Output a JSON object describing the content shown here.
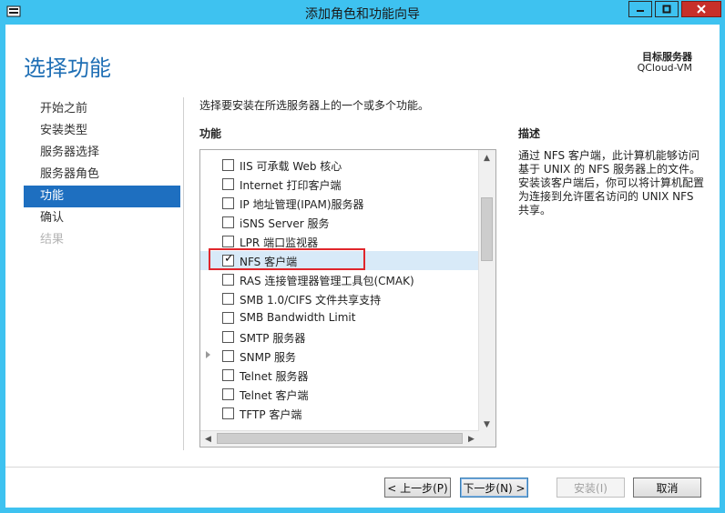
{
  "window": {
    "title": "添加角色和功能向导",
    "minimize_icon": "minimize-icon",
    "maximize_icon": "maximize-icon",
    "close_icon": "close-icon"
  },
  "header": {
    "page_title": "选择功能",
    "dest_server_label": "目标服务器",
    "dest_server_name": "QCloud-VM"
  },
  "nav": {
    "items": [
      {
        "label": "开始之前",
        "state": "normal"
      },
      {
        "label": "安装类型",
        "state": "normal"
      },
      {
        "label": "服务器选择",
        "state": "normal"
      },
      {
        "label": "服务器角色",
        "state": "normal"
      },
      {
        "label": "功能",
        "state": "active"
      },
      {
        "label": "确认",
        "state": "normal"
      },
      {
        "label": "结果",
        "state": "disabled"
      }
    ]
  },
  "main": {
    "instruction": "选择要安装在所选服务器上的一个或多个功能。",
    "features_label": "功能",
    "description_label": "描述",
    "description_text": "通过 NFS 客户端，此计算机能够访问基于 UNIX 的 NFS 服务器上的文件。安装该客户端后，你可以将计算机配置为连接到允许匿名访问的 UNIX NFS 共享。",
    "features": [
      {
        "label": "IIS 可承载 Web 核心",
        "checked": false,
        "expandable": false
      },
      {
        "label": "Internet 打印客户端",
        "checked": false,
        "expandable": false
      },
      {
        "label": "IP 地址管理(IPAM)服务器",
        "checked": false,
        "expandable": false
      },
      {
        "label": "iSNS Server 服务",
        "checked": false,
        "expandable": false
      },
      {
        "label": "LPR 端口监视器",
        "checked": false,
        "expandable": false
      },
      {
        "label": "NFS 客户端",
        "checked": true,
        "expandable": false,
        "selected": true
      },
      {
        "label": "RAS 连接管理器管理工具包(CMAK)",
        "checked": false,
        "expandable": false
      },
      {
        "label": "SMB 1.0/CIFS 文件共享支持",
        "checked": false,
        "expandable": false
      },
      {
        "label": "SMB Bandwidth Limit",
        "checked": false,
        "expandable": false
      },
      {
        "label": "SMTP 服务器",
        "checked": false,
        "expandable": false
      },
      {
        "label": "SNMP 服务",
        "checked": false,
        "expandable": true
      },
      {
        "label": "Telnet 服务器",
        "checked": false,
        "expandable": false
      },
      {
        "label": "Telnet 客户端",
        "checked": false,
        "expandable": false
      },
      {
        "label": "TFTP 客户端",
        "checked": false,
        "expandable": false
      }
    ]
  },
  "footer": {
    "prev_label": "< 上一步(P)",
    "next_label": "下一步(N) >",
    "install_label": "安装(I)",
    "cancel_label": "取消"
  },
  "colors": {
    "titlebar": "#3ec2f0",
    "accent": "#1e6fc0",
    "title_blue": "#1f6fb5",
    "highlight_red": "#e0262c"
  }
}
